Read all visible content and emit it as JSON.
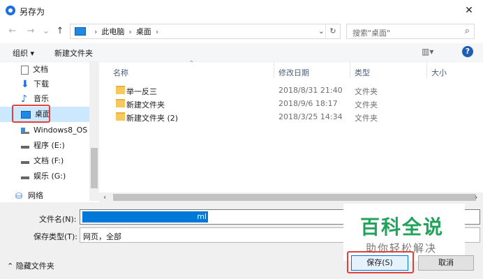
{
  "window": {
    "title": "另存为",
    "close_glyph": "✕"
  },
  "nav": {
    "back": "←",
    "forward": "→",
    "recent": "⌄",
    "up": "↑",
    "breadcrumb": [
      "此电脑",
      "桌面"
    ],
    "dropdown": "⌄",
    "refresh": "↻",
    "search_placeholder": "搜索\"桌面\"",
    "search_icon": "⌕"
  },
  "toolbar": {
    "organize": "组织 ▾",
    "new_folder": "新建文件夹",
    "view": "▥▾",
    "help": "?"
  },
  "sidebar": {
    "items": [
      {
        "label": "文档",
        "icon": "document-icon"
      },
      {
        "label": "下载",
        "icon": "download-icon"
      },
      {
        "label": "音乐",
        "icon": "music-icon"
      },
      {
        "label": "桌面",
        "icon": "desktop-icon"
      },
      {
        "label": "Windows8_OS",
        "icon": "drive-icon"
      },
      {
        "label": "程序 (E:)",
        "icon": "drive-icon"
      },
      {
        "label": "文档 (F:)",
        "icon": "drive-icon"
      },
      {
        "label": "娱乐 (G:)",
        "icon": "drive-icon"
      },
      {
        "label": "网络",
        "icon": "network-icon"
      }
    ]
  },
  "filelist": {
    "columns": [
      "名称",
      "修改日期",
      "类型",
      "大小"
    ],
    "rows": [
      {
        "name": "举一反三",
        "date": "2018/8/31 21:40",
        "type": "文件夹"
      },
      {
        "name": "新建文件夹",
        "date": "2018/9/6 18:17",
        "type": "文件夹"
      },
      {
        "name": "新建文件夹 (2)",
        "date": "2018/3/25 14:34",
        "type": "文件夹"
      }
    ]
  },
  "footer": {
    "filename_label": "文件名(N):",
    "filename_value": "ml",
    "filetype_label": "保存类型(T):",
    "filetype_value": "网页，全部",
    "hide_folders": "⌃  隐藏文件夹",
    "save": "保存(S)",
    "cancel": "取消"
  },
  "watermark": {
    "brand": "百科全说",
    "sub": "助你轻松解决"
  },
  "colors": {
    "accent": "#0078d7",
    "highlight_box": "#e0413a",
    "brand_green": "#21a35c"
  }
}
